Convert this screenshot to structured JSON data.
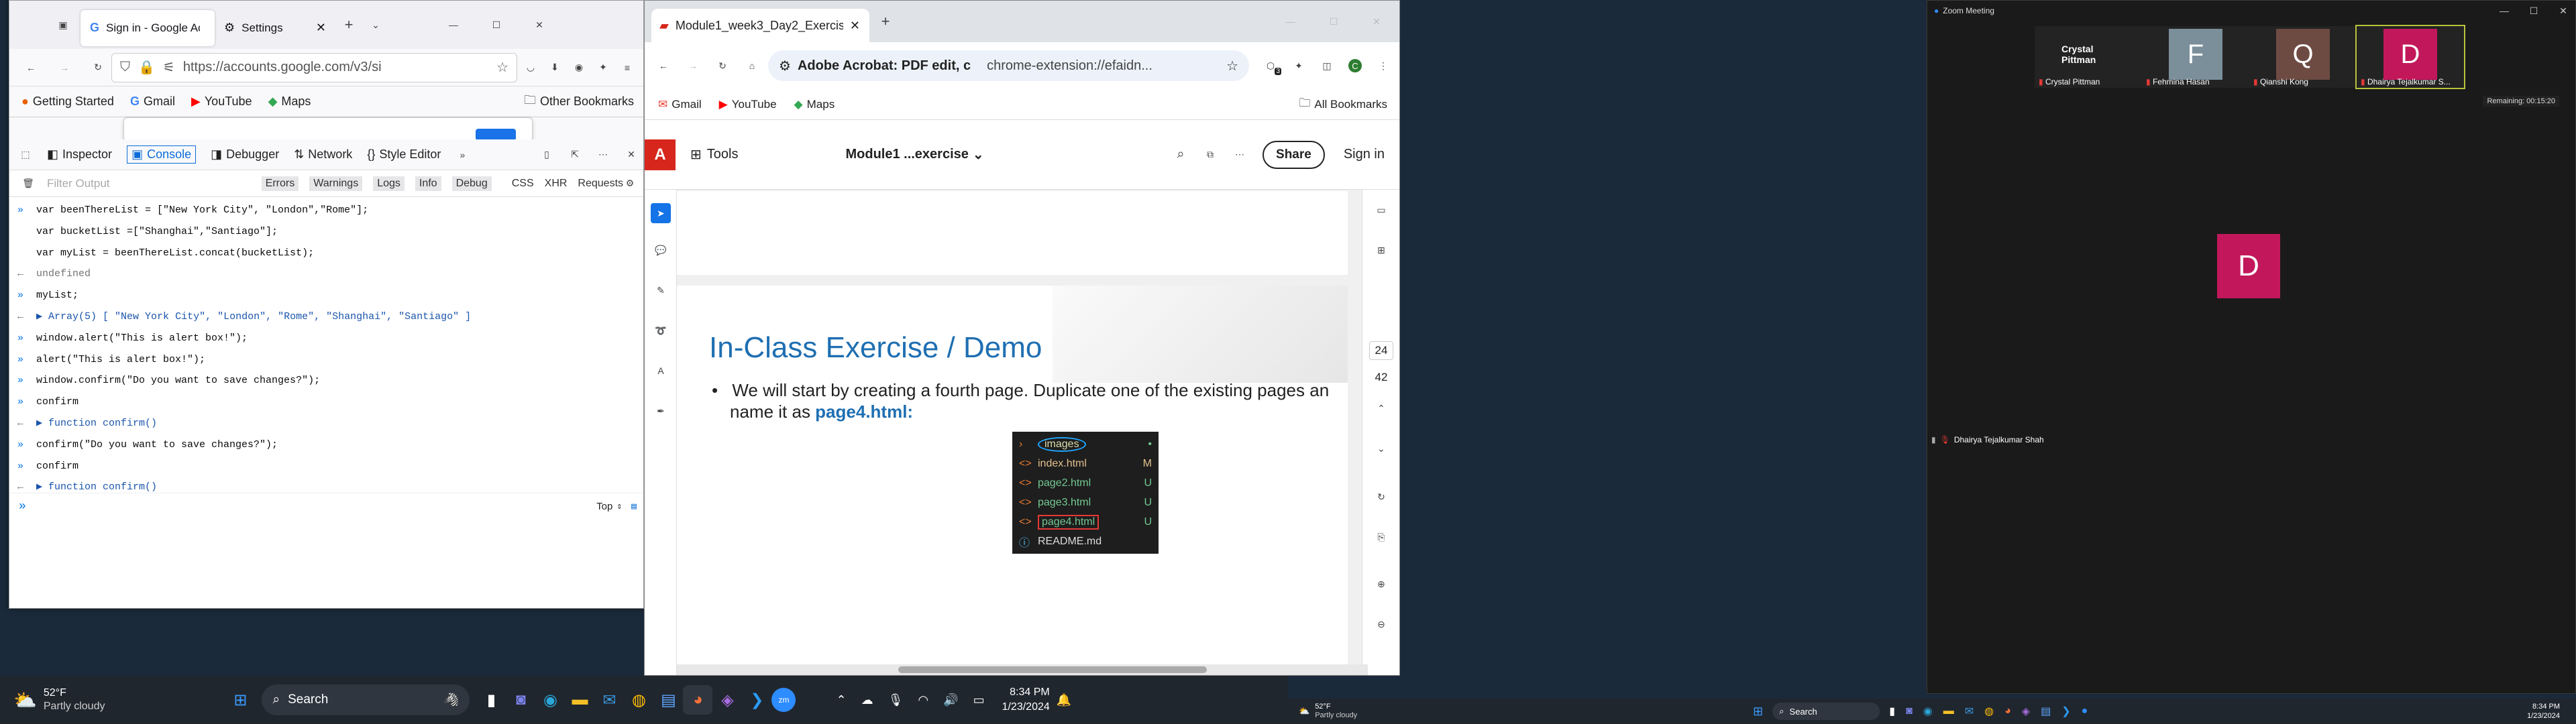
{
  "firefox": {
    "tabs": [
      {
        "label": "Sign in - Google Ac"
      },
      {
        "label": "Settings"
      }
    ],
    "url": "https://accounts.google.com/v3/si",
    "bookmarks": [
      "Getting Started",
      "Gmail",
      "YouTube",
      "Maps"
    ],
    "other_bookmarks": "Other Bookmarks",
    "devtools": {
      "tools": [
        "Inspector",
        "Console",
        "Debugger",
        "Network",
        "Style Editor"
      ],
      "filter_placeholder": "Filter Output",
      "levels": [
        "Errors",
        "Warnings",
        "Logs",
        "Info",
        "Debug"
      ],
      "types": [
        "CSS",
        "XHR",
        "Requests"
      ],
      "context": "Top",
      "console": [
        {
          "kind": "in",
          "text": "var beenThereList = [\"New York City\", \"London\",\"Rome\"];"
        },
        {
          "kind": "cont",
          "text": "var bucketList =[\"Shanghai\",\"Santiago\"];"
        },
        {
          "kind": "blank",
          "text": ""
        },
        {
          "kind": "cont",
          "text": "var myList = beenThereList.concat(bucketList);"
        },
        {
          "kind": "out",
          "text": "undefined"
        },
        {
          "kind": "in",
          "text": "myList;"
        },
        {
          "kind": "out",
          "text": "▶ Array(5) [ \"New York City\", \"London\", \"Rome\", \"Shanghai\", \"Santiago\" ]"
        },
        {
          "kind": "in",
          "text": "window.alert(\"This is alert box!\");"
        },
        {
          "kind": "in",
          "text": "alert(\"This is alert box!\");"
        },
        {
          "kind": "in",
          "text": "window.confirm(\"Do you want to save changes?\");"
        },
        {
          "kind": "in",
          "text": "confirm"
        },
        {
          "kind": "out",
          "text": "▶ function confirm()"
        },
        {
          "kind": "in",
          "text": "confirm(\"Do you want to save changes?\");"
        },
        {
          "kind": "in",
          "text": "confirm"
        },
        {
          "kind": "out",
          "text": "▶ function confirm()"
        }
      ]
    }
  },
  "chrome": {
    "tab": "Module1_week3_Day2_Exercise",
    "site_chip": "Adobe Acrobat: PDF edit, c",
    "url": "chrome-extension://efaidn...",
    "ext_badge": "3",
    "profile": "C",
    "bookmarks": [
      "Gmail",
      "YouTube",
      "Maps"
    ],
    "all_bookmarks": "All Bookmarks",
    "acrobat": {
      "tools": "Tools",
      "doc": "Module1 ...exercise",
      "share": "Share",
      "signin": "Sign in",
      "page": "24",
      "total": "42",
      "slide_title": "In-Class Exercise / Demo",
      "bullet_a": "We will start by creating a fourth page. Duplicate one of the existing pages an",
      "bullet_b": "name it as ",
      "bullet_c": "page4.html:",
      "files": [
        {
          "name": "images",
          "flag": "•"
        },
        {
          "name": "index.html",
          "flag": "M"
        },
        {
          "name": "page2.html",
          "flag": "U"
        },
        {
          "name": "page3.html",
          "flag": "U"
        },
        {
          "name": "page4.html",
          "flag": "U"
        },
        {
          "name": "README.md",
          "flag": ""
        }
      ]
    }
  },
  "zoom": {
    "title": "Zoom Meeting",
    "remaining": "Remaining: 00:15:20",
    "participants": [
      {
        "name": "Crystal Pittman",
        "initial": ""
      },
      {
        "name": "Fehmina Hasan",
        "initial": "F"
      },
      {
        "name": "Qianshi Kong",
        "initial": "Q"
      },
      {
        "name": "Dhairya Tejalkumar S...",
        "initial": "D"
      }
    ],
    "speaker_initial": "D",
    "speaker_name": "Dhairya Tejalkumar Shah"
  },
  "taskbar": {
    "weather_temp": "52°F",
    "weather_desc": "Partly cloudy",
    "search": "Search",
    "time": "8:34 PM",
    "date": "1/23/2024"
  },
  "taskbar2": {
    "weather_temp": "52°F",
    "weather_desc": "Partly cloudy",
    "search": "Search",
    "time": "8:34 PM",
    "date": "1/23/2024"
  },
  "colors": {
    "zoom_d": "#c2185b",
    "acrobat_red": "#d7261c",
    "link_blue": "#0b66d6"
  }
}
